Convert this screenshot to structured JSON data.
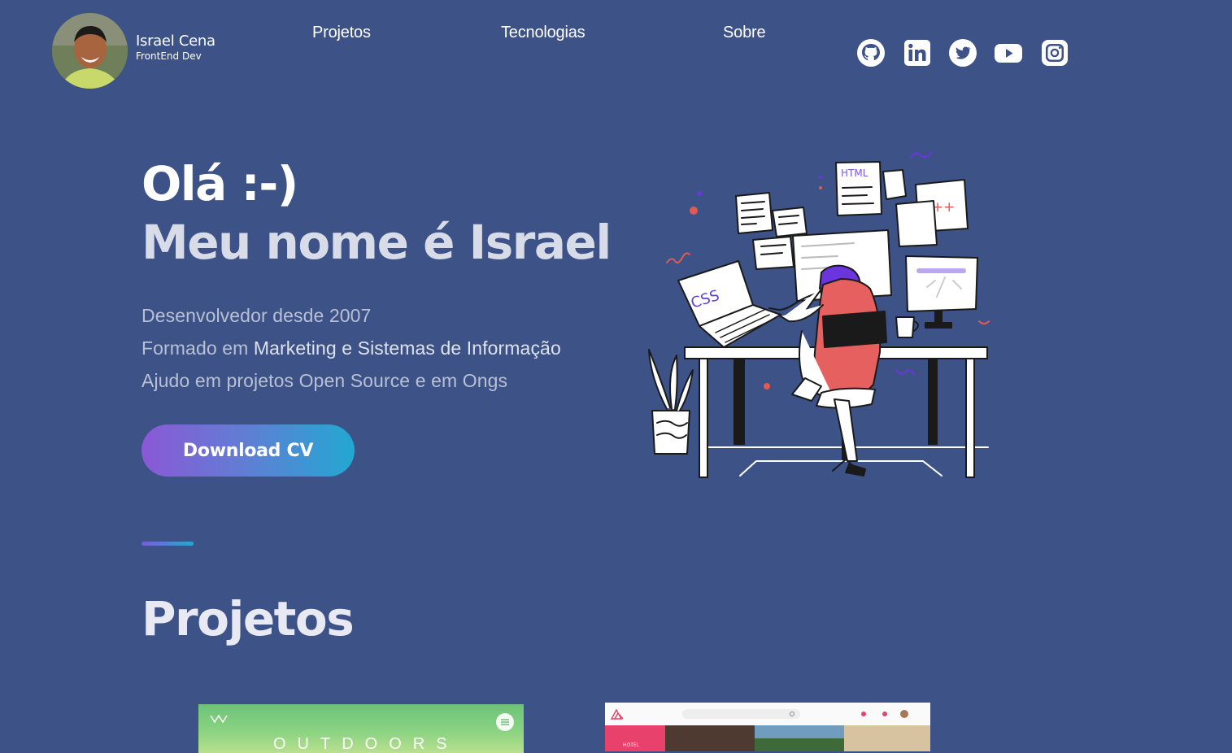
{
  "header": {
    "name": "Israel Cena",
    "role": "FrontEnd Dev"
  },
  "nav": {
    "items": [
      "Projetos",
      "Tecnologias",
      "Sobre"
    ]
  },
  "socials": [
    "github-icon",
    "linkedin-icon",
    "twitter-icon",
    "youtube-icon",
    "instagram-icon"
  ],
  "hero": {
    "title_line1": "Olá :-)",
    "title_line2": "Meu nome é Israel",
    "line1": "Desenvolvedor desde 2007",
    "line2_a": "Formado em ",
    "line2_b": "Marketing e Sistemas de Informação",
    "line3": "Ajudo em projetos Open Source e em Ongs",
    "cta": "Download CV"
  },
  "illustration": {
    "laptop_text": "CSS",
    "doc_text": "HTML",
    "screen_text": "C++"
  },
  "projects": {
    "title": "Projetos",
    "card1_wordmark": "OUTDOORS",
    "card2_tab": "HOTEL"
  },
  "colors": {
    "background": "#3d5286",
    "accent_start": "#8b58d6",
    "accent_end": "#23a7d2"
  }
}
